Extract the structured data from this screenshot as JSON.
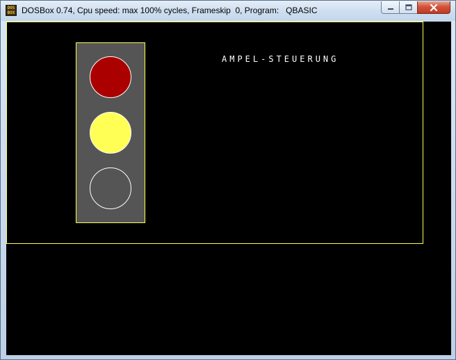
{
  "window": {
    "title": "DOSBox 0.74, Cpu speed: max 100% cycles, Frameskip  0, Program:   QBASIC",
    "icon": "dosbox-icon",
    "icon_text_line1": "DOS",
    "icon_text_line2": "BOX",
    "buttons": [
      "minimize",
      "maximize",
      "close"
    ]
  },
  "program": {
    "heading": "AMPEL-STEUERUNG",
    "traffic_light": {
      "red": "on",
      "yellow": "on",
      "green": "off"
    },
    "colors": {
      "frame_border": "#ffff55",
      "housing": "#555555",
      "red_lamp": "#aa0000",
      "yellow_lamp": "#ffff55",
      "lamp_outline": "#ffffff",
      "background": "#000000"
    }
  }
}
